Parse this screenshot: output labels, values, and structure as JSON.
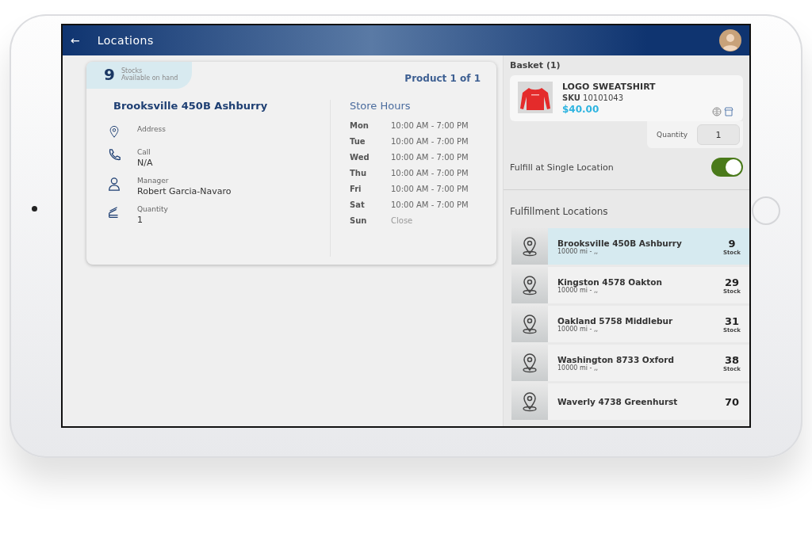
{
  "header": {
    "back": "←",
    "title": "Locations"
  },
  "store_card": {
    "stock_count": "9",
    "stock_label": "Stocks",
    "stock_sub": "Available on hand",
    "product_counter": "Product 1 of 1",
    "store_name": "Brooksville 450B Ashburry",
    "details": [
      {
        "kind": "address",
        "label": "Address"
      },
      {
        "kind": "call",
        "label": "Call",
        "value": "N/A"
      },
      {
        "kind": "manager",
        "label": "Manager",
        "value": "Robert Garcia-Navaro"
      },
      {
        "kind": "quantity",
        "label": "Quantity",
        "value": "1"
      }
    ],
    "hours_title": "Store Hours",
    "hours": [
      {
        "day": "Mon",
        "time": "10:00 AM - 7:00 PM",
        "closed": false
      },
      {
        "day": "Tue",
        "time": "10:00 AM - 7:00 PM",
        "closed": false
      },
      {
        "day": "Wed",
        "time": "10:00 AM - 7:00 PM",
        "closed": false
      },
      {
        "day": "Thu",
        "time": "10:00 AM - 7:00 PM",
        "closed": false
      },
      {
        "day": "Fri",
        "time": "10:00 AM - 7:00 PM",
        "closed": false
      },
      {
        "day": "Sat",
        "time": "10:00 AM - 7:00 PM",
        "closed": false
      },
      {
        "day": "Sun",
        "time": "Close",
        "closed": true
      }
    ]
  },
  "basket": {
    "title": "Basket (1)",
    "product": {
      "name": "LOGO SWEATSHIRT",
      "sku_label": "SKU",
      "sku": "10101043",
      "price": "$40.00"
    },
    "quantity_label": "Quantity",
    "quantity": "1"
  },
  "single_location": {
    "label": "Fulfill at Single Location",
    "on": true
  },
  "fulfillment": {
    "title": "Fulfillment Locations",
    "locations": [
      {
        "name": "Brooksville 450B Ashburry",
        "distance": "10000 mi - ,,",
        "stock": "9",
        "stock_label": "Stock",
        "selected": true
      },
      {
        "name": "Kingston 4578 Oakton",
        "distance": "10000 mi - ,,",
        "stock": "29",
        "stock_label": "Stock",
        "selected": false
      },
      {
        "name": "Oakland 5758 Middlebur",
        "distance": "10000 mi - ,,",
        "stock": "31",
        "stock_label": "Stock",
        "selected": false
      },
      {
        "name": "Washington 8733 Oxford",
        "distance": "10000 mi - ,,",
        "stock": "38",
        "stock_label": "Stock",
        "selected": false
      },
      {
        "name": "Waverly 4738 Greenhurst",
        "stock": "70",
        "selected": false
      }
    ]
  }
}
